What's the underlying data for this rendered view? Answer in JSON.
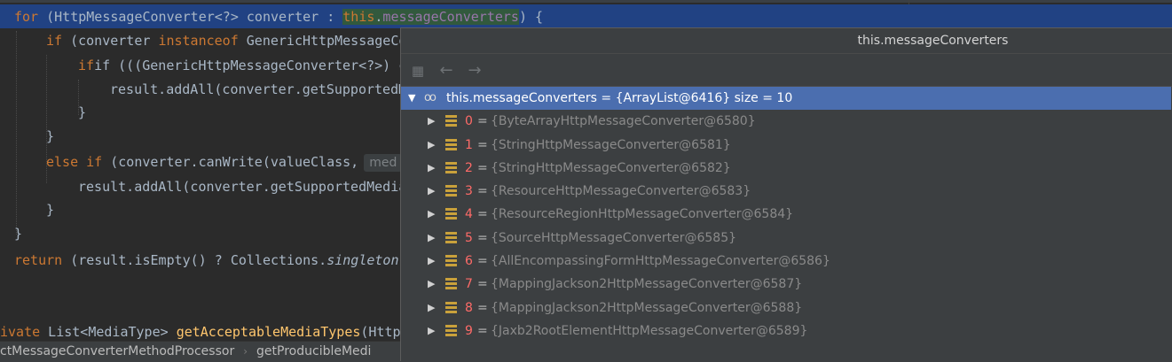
{
  "editor": {
    "lines": [
      {
        "kw1": "for",
        "a": " (HttpMessageConverter<?> converter : ",
        "kw2": "this",
        "b": ".",
        "fld": "messageConverters",
        "c": ") {"
      },
      {
        "kw1": "if",
        "a": " (converter ",
        "kw2": "instanceof",
        "b": " GenericHttpMessageCo"
      },
      {
        "a": "if (((GenericHttpMessageConverter<?>) cor"
      },
      {
        "a": "result.addAll(converter.getSupportedM"
      },
      {
        "a": "}"
      },
      {
        "a": "}"
      },
      {
        "kw1": "else if",
        "a": " (converter.canWrite(valueClass,",
        "hint": "med"
      },
      {
        "a": "result.addAll(converter.getSupportedMedia"
      },
      {
        "a": "}"
      },
      {
        "a": "}"
      },
      {
        "kw1": "return",
        "a": " (result.isEmpty() ? Collections.",
        "it": "singleton"
      }
    ],
    "partial_line": {
      "kw1": "ivate",
      "a": " List<MediaType> ",
      "fn": "getAcceptableMediaTypes",
      "b": "(Http"
    }
  },
  "breadcrumb": {
    "items": [
      "ctMessageConverterMethodProcessor",
      "getProducibleMedi"
    ],
    "separator": "›"
  },
  "popup": {
    "title": "this.messageConverters",
    "toolbar": {
      "tree_icon": "▦",
      "back_icon": "←",
      "forward_icon": "→"
    },
    "root": {
      "expand": "▼",
      "icon": "oo",
      "label": "this.messageConverters = {ArrayList@6416}  size = 10"
    },
    "items": [
      {
        "index": "0",
        "value": "{ByteArrayHttpMessageConverter@6580}"
      },
      {
        "index": "1",
        "value": "{StringHttpMessageConverter@6581}"
      },
      {
        "index": "2",
        "value": "{StringHttpMessageConverter@6582}"
      },
      {
        "index": "3",
        "value": "{ResourceHttpMessageConverter@6583}"
      },
      {
        "index": "4",
        "value": "{ResourceRegionHttpMessageConverter@6584}"
      },
      {
        "index": "5",
        "value": "{SourceHttpMessageConverter@6585}"
      },
      {
        "index": "6",
        "value": "{AllEncompassingFormHttpMessageConverter@6586}"
      },
      {
        "index": "7",
        "value": "{MappingJackson2HttpMessageConverter@6587}"
      },
      {
        "index": "8",
        "value": "{MappingJackson2HttpMessageConverter@6588}"
      },
      {
        "index": "9",
        "value": "{Jaxb2RootElementHttpMessageConverter@6589}"
      }
    ],
    "collapsed_arrow": "▶",
    "equals": "=",
    "colors": {
      "selection": "#4b6eaf",
      "index": "#ff6b68",
      "field_icon": "#c9a13b"
    }
  }
}
